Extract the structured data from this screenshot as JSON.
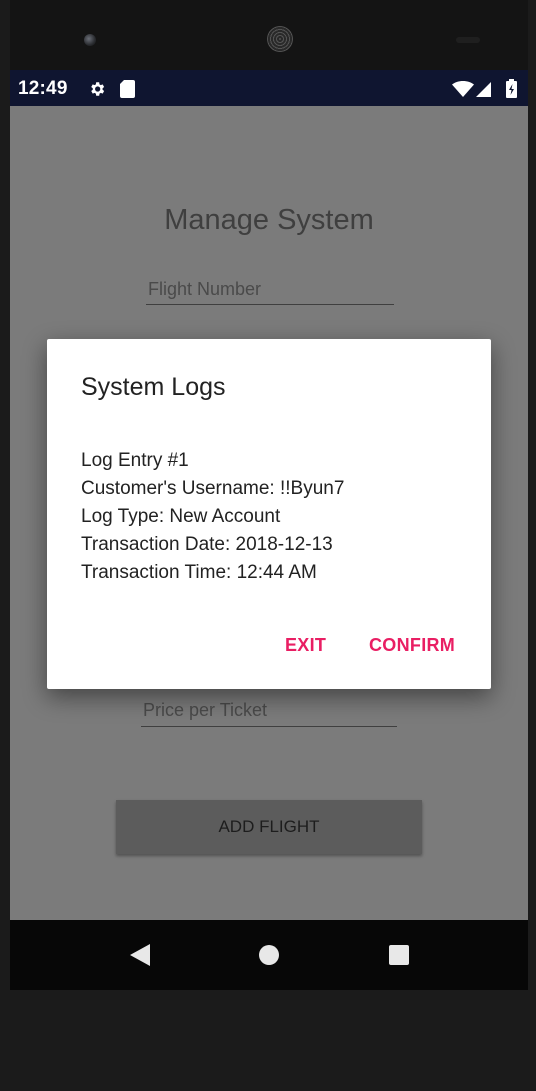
{
  "status_bar": {
    "time": "12:49",
    "icons": [
      "gear-icon",
      "sd-card-icon",
      "wifi-icon",
      "signal-icon",
      "battery-icon"
    ]
  },
  "app": {
    "title": "Manage System",
    "flight_number_placeholder": "Flight Number",
    "price_placeholder": "Price per Ticket",
    "add_flight_label": "ADD FLIGHT"
  },
  "dialog": {
    "title": "System Logs",
    "lines": [
      "Log Entry #1",
      "Customer's Username: !!Byun7",
      "Log Type: New Account",
      "Transaction Date: 2018-12-13",
      "Transaction Time: 12:44 AM"
    ],
    "exit_label": "EXIT",
    "confirm_label": "CONFIRM"
  },
  "nav_bar": {
    "icons": [
      "back-icon",
      "home-icon",
      "recents-icon"
    ]
  },
  "colors": {
    "status_bar": "#0f1530",
    "accent": "#e91e63",
    "scrim": "#7b7b7b"
  }
}
